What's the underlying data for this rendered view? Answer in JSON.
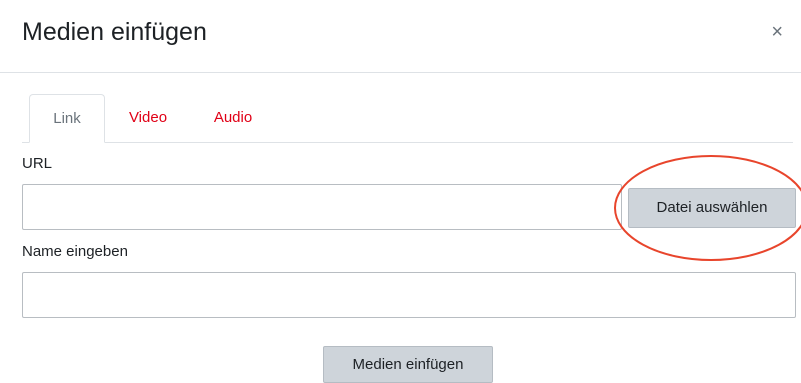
{
  "dialog": {
    "title": "Medien einfügen",
    "close_symbol": "×"
  },
  "tabs": [
    {
      "label": "Link",
      "active": true
    },
    {
      "label": "Video",
      "active": false
    },
    {
      "label": "Audio",
      "active": false
    }
  ],
  "link_form": {
    "url_label": "URL",
    "url_value": "",
    "browse_button_label": "Datei auswählen",
    "name_label": "Name eingeben",
    "name_value": ""
  },
  "footer": {
    "insert_button_label": "Medien einfügen"
  },
  "colors": {
    "tab_link": "#e00016",
    "annotation_circle": "#e8452c",
    "button_bg": "#ced4da"
  },
  "icons": {
    "close": "close-icon"
  }
}
